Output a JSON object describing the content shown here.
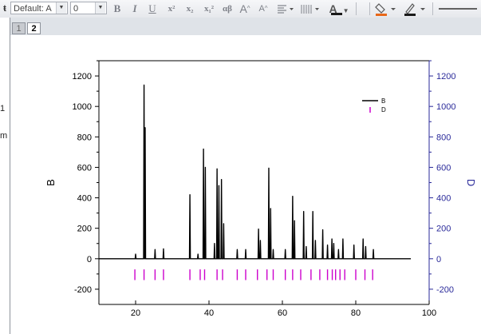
{
  "toolbar": {
    "font_name": "Default: A",
    "font_size": "0",
    "bold": "B",
    "italic": "I",
    "underline": "U",
    "superscript": "x²",
    "subscript": "x₂",
    "supsub": "x₁²",
    "greek": "αβ",
    "grow_font": "A",
    "shrink_font": "A",
    "align_icon": "align-left-icon",
    "line_width_icon": "line-width-icon",
    "font_color": "A",
    "fill_icon": "fill-color-icon",
    "pen_icon": "line-color-icon",
    "colors": {
      "font_color_bar": "#1a1a1a",
      "fill_bar": "#e8681a",
      "line_bar": "#1a1a1a"
    }
  },
  "layers": [
    {
      "label": "1",
      "active": false
    },
    {
      "label": "2",
      "active": true
    }
  ],
  "chart_data": {
    "type": "line",
    "xlim": [
      10,
      100
    ],
    "ylim": [
      -300,
      1300
    ],
    "y2lim": [
      -300,
      1300
    ],
    "x_ticks": [
      20,
      40,
      60,
      80,
      100
    ],
    "y_ticks": [
      -200,
      0,
      200,
      400,
      600,
      800,
      1000,
      1200
    ],
    "y2_ticks": [
      -200,
      0,
      200,
      400,
      600,
      800,
      1000,
      1200
    ],
    "ylabel": "B",
    "y2label": "D",
    "legend": [
      {
        "label": "B",
        "color": "#000000",
        "style": "line"
      },
      {
        "label": "D",
        "color": "#cc00cc",
        "style": "bar"
      }
    ],
    "legend_position": "top-right",
    "series": [
      {
        "name": "B",
        "color": "#000000",
        "baseline": 0,
        "x_range": [
          10,
          95
        ],
        "peaks": [
          {
            "x": 20.0,
            "y": 30
          },
          {
            "x": 22.3,
            "y": 1140
          },
          {
            "x": 22.6,
            "y": 860
          },
          {
            "x": 25.3,
            "y": 60
          },
          {
            "x": 27.6,
            "y": 65
          },
          {
            "x": 34.8,
            "y": 420
          },
          {
            "x": 37.0,
            "y": 30
          },
          {
            "x": 38.5,
            "y": 720
          },
          {
            "x": 39.0,
            "y": 600
          },
          {
            "x": 41.5,
            "y": 100
          },
          {
            "x": 42.2,
            "y": 590
          },
          {
            "x": 42.7,
            "y": 480
          },
          {
            "x": 43.4,
            "y": 520
          },
          {
            "x": 44.0,
            "y": 230
          },
          {
            "x": 47.7,
            "y": 60
          },
          {
            "x": 50.0,
            "y": 60
          },
          {
            "x": 53.5,
            "y": 195
          },
          {
            "x": 54.0,
            "y": 120
          },
          {
            "x": 56.3,
            "y": 595
          },
          {
            "x": 56.8,
            "y": 330
          },
          {
            "x": 57.5,
            "y": 60
          },
          {
            "x": 60.8,
            "y": 60
          },
          {
            "x": 62.8,
            "y": 410
          },
          {
            "x": 63.3,
            "y": 250
          },
          {
            "x": 65.8,
            "y": 310
          },
          {
            "x": 66.5,
            "y": 80
          },
          {
            "x": 68.3,
            "y": 310
          },
          {
            "x": 69.0,
            "y": 120
          },
          {
            "x": 71.0,
            "y": 190
          },
          {
            "x": 72.3,
            "y": 90
          },
          {
            "x": 73.5,
            "y": 130
          },
          {
            "x": 74.0,
            "y": 100
          },
          {
            "x": 75.3,
            "y": 60
          },
          {
            "x": 76.5,
            "y": 130
          },
          {
            "x": 79.5,
            "y": 90
          },
          {
            "x": 82.0,
            "y": 130
          },
          {
            "x": 82.7,
            "y": 80
          },
          {
            "x": 84.8,
            "y": 60
          }
        ]
      },
      {
        "name": "D",
        "axis": "right",
        "color": "#cc00cc",
        "ticks": [
          19.8,
          22.3,
          25.3,
          27.6,
          34.8,
          37.6,
          38.8,
          42.2,
          43.7,
          47.7,
          50.0,
          53.2,
          55.8,
          57.5,
          60.8,
          62.8,
          65.0,
          67.8,
          70.2,
          72.3,
          73.6,
          74.5,
          75.7,
          77.0,
          80.0,
          82.5,
          84.6
        ],
        "tick_top": -70,
        "tick_bottom": -140
      }
    ]
  }
}
